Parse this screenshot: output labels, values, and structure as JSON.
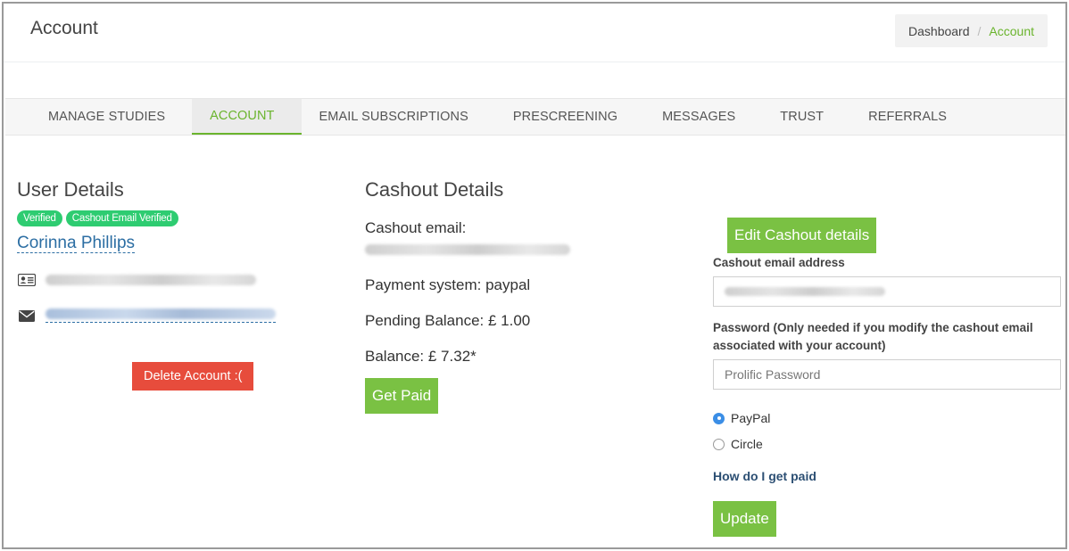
{
  "header": {
    "title": "Account"
  },
  "breadcrumb": {
    "items": [
      "Dashboard",
      "Account"
    ],
    "separator": "/"
  },
  "tabs": [
    {
      "label": "MANAGE STUDIES",
      "active": false
    },
    {
      "label": "ACCOUNT",
      "active": true
    },
    {
      "label": "EMAIL SUBSCRIPTIONS",
      "active": false
    },
    {
      "label": "PRESCREENING",
      "active": false
    },
    {
      "label": "MESSAGES",
      "active": false
    },
    {
      "label": "TRUST",
      "active": false
    },
    {
      "label": "REFERRALS",
      "active": false
    }
  ],
  "user_details": {
    "heading": "User Details",
    "badges": [
      "Verified",
      "Cashout Email Verified"
    ],
    "name_first": "Corinna",
    "name_last": "Phillips",
    "icons": {
      "id": "id-card-icon",
      "email": "envelope-icon"
    },
    "delete_button": "Delete Account :("
  },
  "cashout_details": {
    "heading": "Cashout Details",
    "email_label": "Cashout email:",
    "payment_system": "Payment system: paypal",
    "pending_balance": "Pending Balance: £ 1.00",
    "balance": "Balance: £ 7.32*",
    "get_paid_button": "Get Paid"
  },
  "edit_form": {
    "edit_button": "Edit Cashout details",
    "email_label": "Cashout email address",
    "password_label": "Password (Only needed if you modify the cashout email associated with your account)",
    "password_placeholder": "Prolific Password",
    "options": [
      {
        "label": "PayPal",
        "selected": true
      },
      {
        "label": "Circle",
        "selected": false
      }
    ],
    "help_link": "How do I get paid",
    "update_button": "Update"
  },
  "colors": {
    "accent": "#7ac143",
    "active_tab": "#6ab42d",
    "danger": "#e74c3c",
    "badge": "#2ecc71",
    "link": "#2c6ea3"
  }
}
